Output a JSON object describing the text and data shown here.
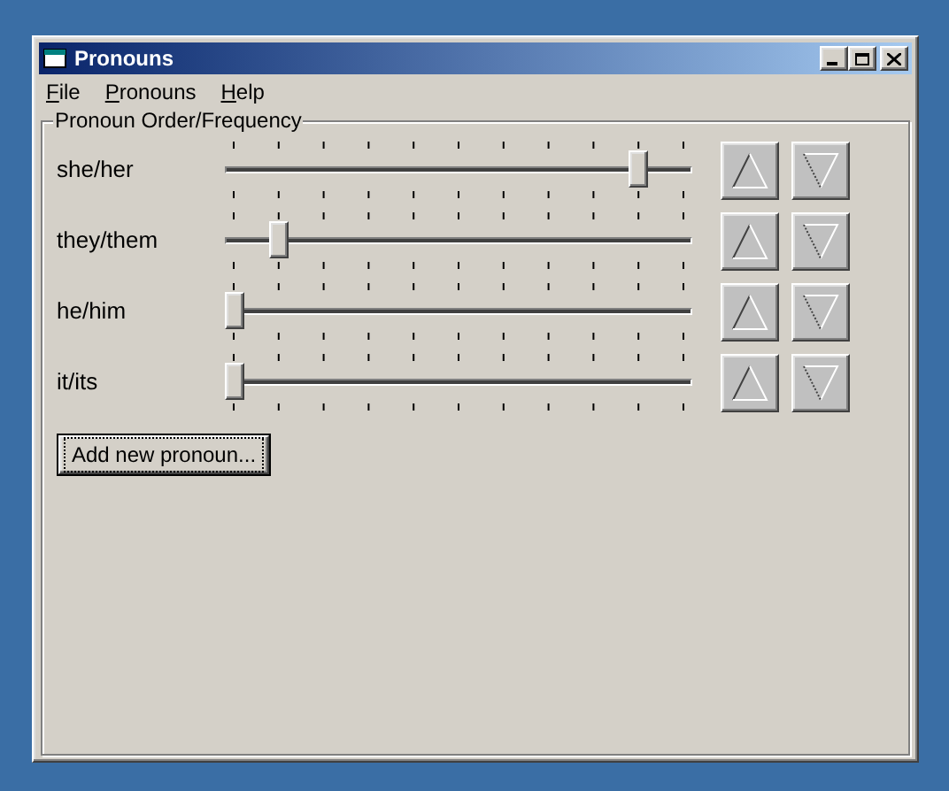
{
  "window": {
    "title": "Pronouns"
  },
  "menu": [
    "File",
    "Pronouns",
    "Help"
  ],
  "group": {
    "title": "Pronoun Order/Frequency"
  },
  "pronouns": [
    {
      "name": "she/her",
      "level": 0.9
    },
    {
      "name": "they/them",
      "level": 0.1
    },
    {
      "name": "he/him",
      "level": 0
    },
    {
      "name": "it/its",
      "level": 0
    }
  ],
  "add_button": "Add new pronoun..."
}
